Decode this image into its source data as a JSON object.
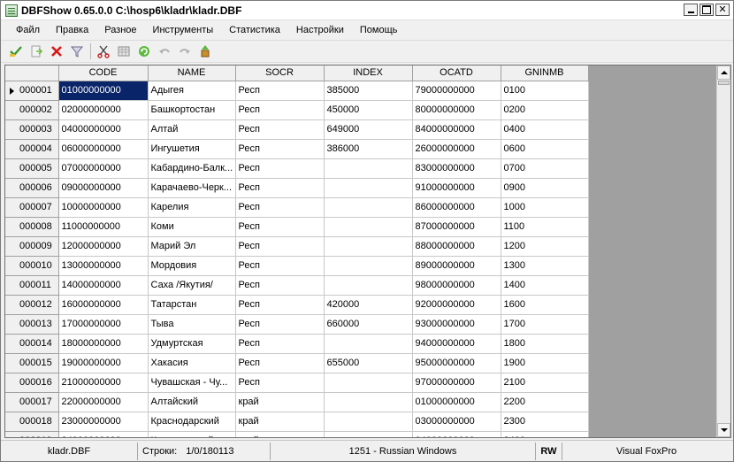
{
  "window": {
    "title": "DBFShow 0.65.0.0  C:\\hosp6\\kladr\\kladr.DBF",
    "min_label": "",
    "max_label": "",
    "close_label": "✕"
  },
  "menu": [
    "Файл",
    "Правка",
    "Разное",
    "Инструменты",
    "Статистика",
    "Настройки",
    "Помощь"
  ],
  "toolbar": {
    "buttons": [
      "ok-check-icon",
      "export-icon",
      "delete-icon",
      "filter-icon",
      "cut-icon",
      "grid-icon",
      "refresh-icon",
      "undo-icon",
      "redo-icon",
      "tools-icon"
    ]
  },
  "grid": {
    "columns": [
      "",
      "CODE",
      "NAME",
      "SOCR",
      "INDEX",
      "OCATD",
      "GNINMB"
    ],
    "rows": [
      {
        "num": "000001",
        "code": "01000000000",
        "name": "Адыгея",
        "socr": "Респ",
        "index": "385000",
        "ocatd": "79000000000",
        "gninmb": "0100"
      },
      {
        "num": "000002",
        "code": "02000000000",
        "name": "Башкортостан",
        "socr": "Респ",
        "index": "450000",
        "ocatd": "80000000000",
        "gninmb": "0200"
      },
      {
        "num": "000003",
        "code": "04000000000",
        "name": "Алтай",
        "socr": "Респ",
        "index": "649000",
        "ocatd": "84000000000",
        "gninmb": "0400"
      },
      {
        "num": "000004",
        "code": "06000000000",
        "name": "Ингушетия",
        "socr": "Респ",
        "index": "386000",
        "ocatd": "26000000000",
        "gninmb": "0600"
      },
      {
        "num": "000005",
        "code": "07000000000",
        "name": "Кабардино-Балк...",
        "socr": "Респ",
        "index": "",
        "ocatd": "83000000000",
        "gninmb": "0700"
      },
      {
        "num": "000006",
        "code": "09000000000",
        "name": "Карачаево-Черк...",
        "socr": "Респ",
        "index": "",
        "ocatd": "91000000000",
        "gninmb": "0900"
      },
      {
        "num": "000007",
        "code": "10000000000",
        "name": "Карелия",
        "socr": "Респ",
        "index": "",
        "ocatd": "86000000000",
        "gninmb": "1000"
      },
      {
        "num": "000008",
        "code": "11000000000",
        "name": "Коми",
        "socr": "Респ",
        "index": "",
        "ocatd": "87000000000",
        "gninmb": "1100"
      },
      {
        "num": "000009",
        "code": "12000000000",
        "name": "Марий Эл",
        "socr": "Респ",
        "index": "",
        "ocatd": "88000000000",
        "gninmb": "1200"
      },
      {
        "num": "000010",
        "code": "13000000000",
        "name": "Мордовия",
        "socr": "Респ",
        "index": "",
        "ocatd": "89000000000",
        "gninmb": "1300"
      },
      {
        "num": "000011",
        "code": "14000000000",
        "name": "Саха /Якутия/",
        "socr": "Респ",
        "index": "",
        "ocatd": "98000000000",
        "gninmb": "1400"
      },
      {
        "num": "000012",
        "code": "16000000000",
        "name": "Татарстан",
        "socr": "Респ",
        "index": "420000",
        "ocatd": "92000000000",
        "gninmb": "1600"
      },
      {
        "num": "000013",
        "code": "17000000000",
        "name": "Тыва",
        "socr": "Респ",
        "index": "660000",
        "ocatd": "93000000000",
        "gninmb": "1700"
      },
      {
        "num": "000014",
        "code": "18000000000",
        "name": "Удмуртская",
        "socr": "Респ",
        "index": "",
        "ocatd": "94000000000",
        "gninmb": "1800"
      },
      {
        "num": "000015",
        "code": "19000000000",
        "name": "Хакасия",
        "socr": "Респ",
        "index": "655000",
        "ocatd": "95000000000",
        "gninmb": "1900"
      },
      {
        "num": "000016",
        "code": "21000000000",
        "name": "Чувашская - Чу...",
        "socr": "Респ",
        "index": "",
        "ocatd": "97000000000",
        "gninmb": "2100"
      },
      {
        "num": "000017",
        "code": "22000000000",
        "name": "Алтайский",
        "socr": "край",
        "index": "",
        "ocatd": "01000000000",
        "gninmb": "2200"
      },
      {
        "num": "000018",
        "code": "23000000000",
        "name": "Краснодарский",
        "socr": "край",
        "index": "",
        "ocatd": "03000000000",
        "gninmb": "2300"
      },
      {
        "num": "000019",
        "code": "24000000000",
        "name": "Красноярский",
        "socr": "край",
        "index": "",
        "ocatd": "04000000000",
        "gninmb": "2400"
      }
    ]
  },
  "status": {
    "file": "kladr.DBF",
    "rows_label": "Строки:",
    "rows_value": "1/0/180113",
    "codepage": "1251 - Russian Windows",
    "mode": "RW",
    "format": "Visual FoxPro"
  },
  "colors": {
    "selection": "#0a246a",
    "chrome": "#f0f0f0",
    "empty_grid": "#a0a0a0"
  }
}
